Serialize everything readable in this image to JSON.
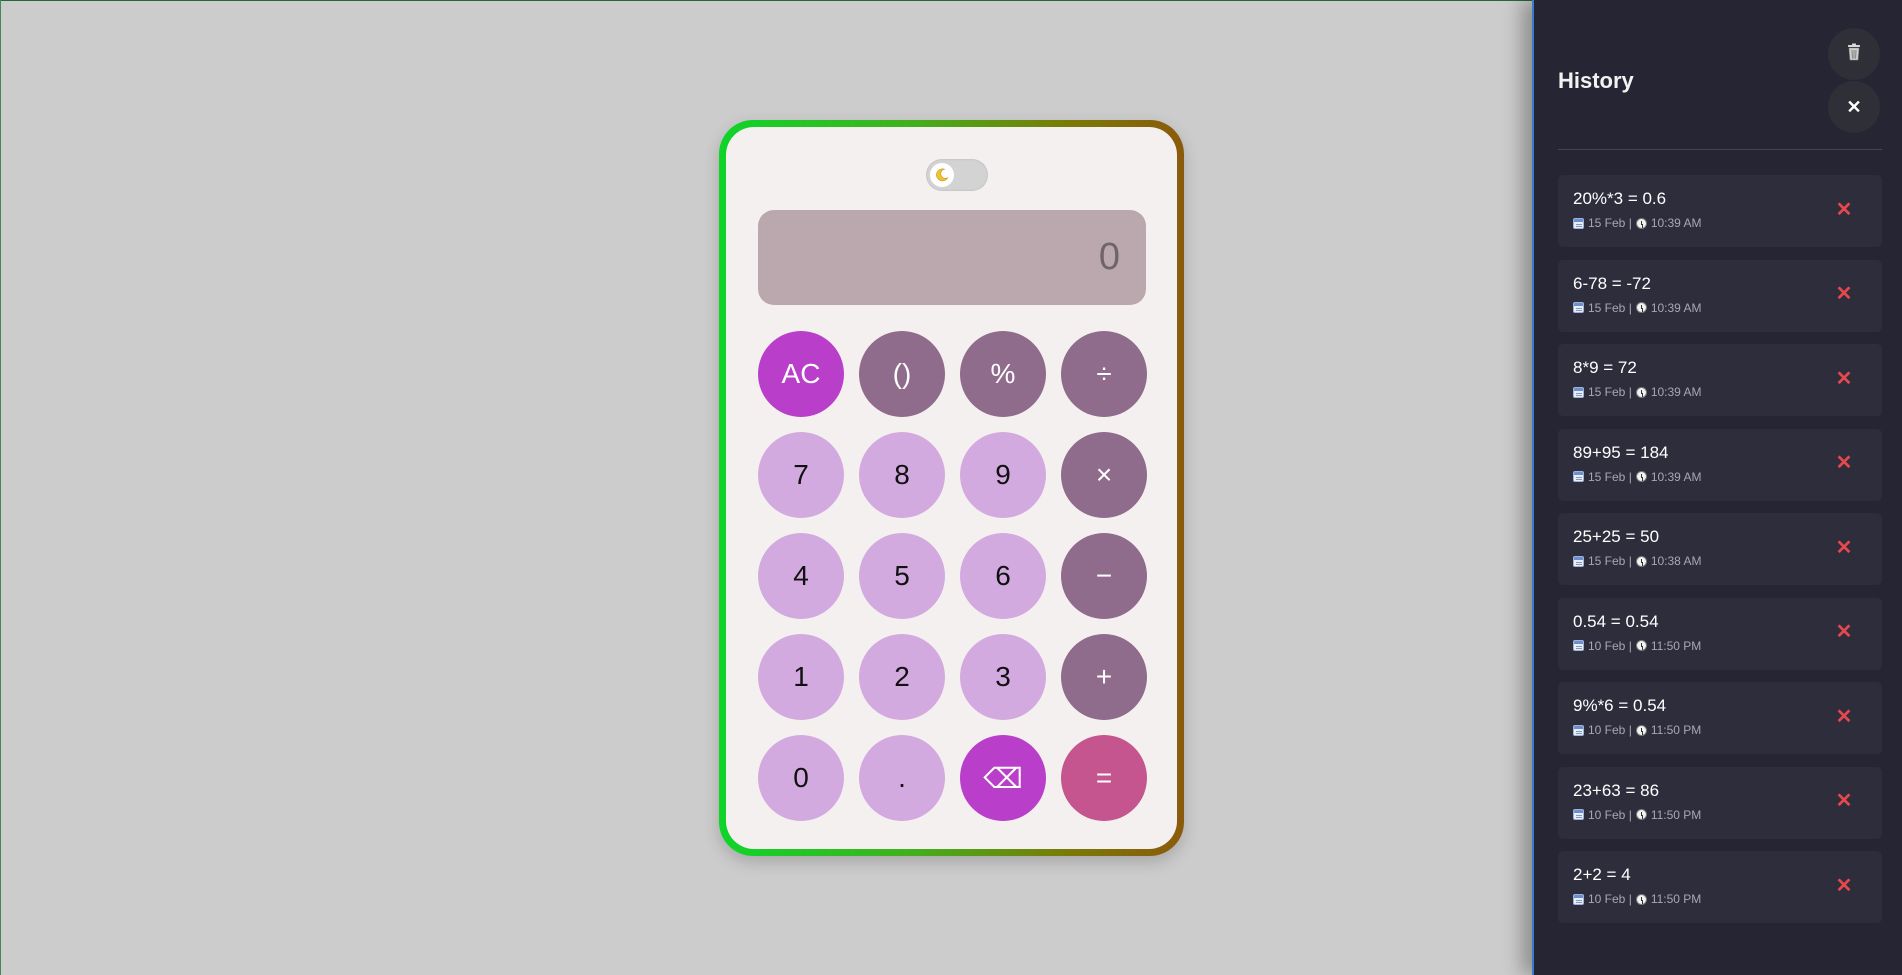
{
  "calculator": {
    "theme_toggle_icon": "moon-icon",
    "display_value": "0",
    "keys": [
      {
        "label": "AC",
        "kind": "accent",
        "name": "all-clear-button"
      },
      {
        "label": "()",
        "kind": "op",
        "name": "parentheses-button"
      },
      {
        "label": "%",
        "kind": "op",
        "name": "percent-button"
      },
      {
        "label": "÷",
        "kind": "op",
        "name": "divide-button"
      },
      {
        "label": "7",
        "kind": "num",
        "name": "digit-7-button"
      },
      {
        "label": "8",
        "kind": "num",
        "name": "digit-8-button"
      },
      {
        "label": "9",
        "kind": "num",
        "name": "digit-9-button"
      },
      {
        "label": "×",
        "kind": "op",
        "name": "multiply-button"
      },
      {
        "label": "4",
        "kind": "num",
        "name": "digit-4-button"
      },
      {
        "label": "5",
        "kind": "num",
        "name": "digit-5-button"
      },
      {
        "label": "6",
        "kind": "num",
        "name": "digit-6-button"
      },
      {
        "label": "−",
        "kind": "op",
        "name": "subtract-button"
      },
      {
        "label": "1",
        "kind": "num",
        "name": "digit-1-button"
      },
      {
        "label": "2",
        "kind": "num",
        "name": "digit-2-button"
      },
      {
        "label": "3",
        "kind": "num",
        "name": "digit-3-button"
      },
      {
        "label": "+",
        "kind": "op",
        "name": "add-button"
      },
      {
        "label": "0",
        "kind": "num",
        "name": "digit-0-button"
      },
      {
        "label": ".",
        "kind": "num",
        "name": "decimal-button"
      },
      {
        "label": "⌫",
        "kind": "accent",
        "name": "backspace-button"
      },
      {
        "label": "=",
        "kind": "eq",
        "name": "equals-button"
      }
    ]
  },
  "history": {
    "title": "History",
    "trash_icon": "trash-icon",
    "close_icon": "close-icon",
    "close_glyph": "✕",
    "delete_glyph": "✕",
    "items": [
      {
        "expression": "20%*3 = 0.6",
        "date": "15 Feb |",
        "time": "10:39 AM"
      },
      {
        "expression": "6-78 = -72",
        "date": "15 Feb |",
        "time": "10:39 AM"
      },
      {
        "expression": "8*9 = 72",
        "date": "15 Feb |",
        "time": "10:39 AM"
      },
      {
        "expression": "89+95 = 184",
        "date": "15 Feb |",
        "time": "10:39 AM"
      },
      {
        "expression": "25+25 = 50",
        "date": "15 Feb |",
        "time": "10:38 AM"
      },
      {
        "expression": "0.54 = 0.54",
        "date": "10 Feb |",
        "time": "11:50 PM"
      },
      {
        "expression": "9%*6 = 0.54",
        "date": "10 Feb |",
        "time": "11:50 PM"
      },
      {
        "expression": "23+63 = 86",
        "date": "10 Feb |",
        "time": "11:50 PM"
      },
      {
        "expression": "2+2 = 4",
        "date": "10 Feb |",
        "time": "11:50 PM"
      }
    ]
  },
  "colors": {
    "background": "#cccccc",
    "calc_body": "#f5f0f0",
    "display_bg": "#bba8ae",
    "key_number": "#d3aadf",
    "key_operator": "#8f6b8c",
    "key_accent": "#b93fca",
    "key_equals": "#c4558e",
    "border_gradient_start": "#0fd42a",
    "border_gradient_end": "#8b5a0b",
    "panel_bg": "#262534",
    "history_item_bg": "#2e2d3c",
    "delete_red": "#e5484d"
  }
}
